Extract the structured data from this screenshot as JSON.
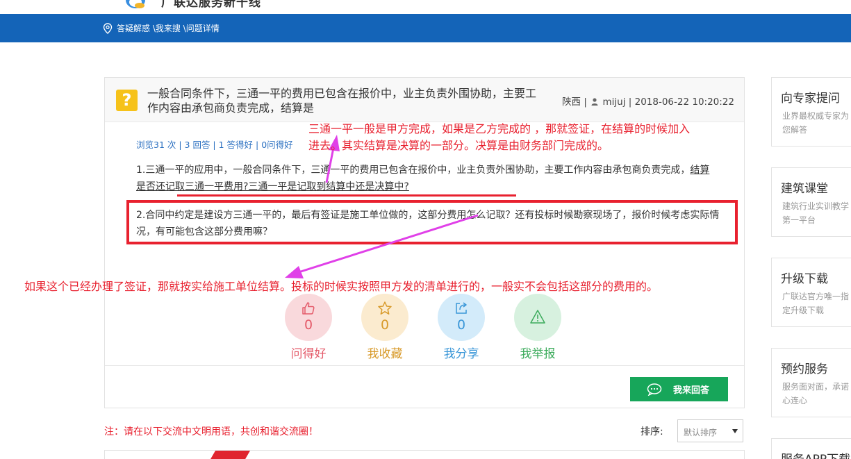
{
  "header": {
    "logo_text": "广联达服务新干线",
    "breadcrumb": "答疑解惑 \\我来搜 \\问题详情"
  },
  "question": {
    "title": "一般合同条件下，三通一平的费用已包含在报价中，业主负责外围协助，主要工作内容由承包商负责完成，结算是",
    "region": "陕西",
    "user": "mijuj",
    "datetime": "2018-06-22 10:20:22",
    "stats": "浏览31 次 | 3 回答 | 1 答得好 | 0问得好",
    "para1_plain": "1.三通一平的应用中，一般合同条件下，三通一平的费用已包含在报价中，业主负责外围协助，主要工作内容由承包商负责完成，",
    "para1_underlined": "结算是否还记取三通一平费用?三通一平是记取到结算中还是决算中?",
    "para2": "2.合同中约定是建设方三通一平的，最后有签证是施工单位做的，这部分费用怎么记取？还有投标时候勘察现场了，报价时候考虑实际情况，有可能包含这部分费用嘛？"
  },
  "actions": {
    "good_count": "0",
    "good_label": "问得好",
    "fav_count": "0",
    "fav_label": "我收藏",
    "share_count": "0",
    "share_label": "我分享",
    "report_label": "我举报"
  },
  "answer_button": "我来回答",
  "notice": "注：请在以下交流中文明用语，共创和谐交流圈！",
  "sort": {
    "label": "排序:",
    "selected": "默认排序"
  },
  "sidebar": [
    {
      "title": "向专家提问",
      "desc": "业界最权威专家为您解答"
    },
    {
      "title": "建筑课堂",
      "desc": "建筑行业实训教学第一平台"
    },
    {
      "title": "升级下载",
      "desc": "广联达官方唯一指定升级下载"
    },
    {
      "title": "预约服务",
      "desc": "服务面对面，承诺心连心"
    },
    {
      "title": "服务APP下载",
      "desc": ""
    }
  ],
  "annotations": {
    "top_line1": "三通一平一般是甲方完成，如果是乙方完成的 ，那就签证，在结算的时候加入",
    "top_line2": "进去。其实结算是决算的一部分。决算是由财务部门完成的。",
    "bottom": "如果这个已经办理了签证，那就按实给施工单位结算。投标的时候实按照甲方发的清单进行的，一般实不会包括这部分的费用的。"
  },
  "colors": {
    "nav_blue": "#1464b8",
    "annotation_red": "#e8212f",
    "arrow_magenta": "#e040e8",
    "answer_green": "#17a65a"
  }
}
